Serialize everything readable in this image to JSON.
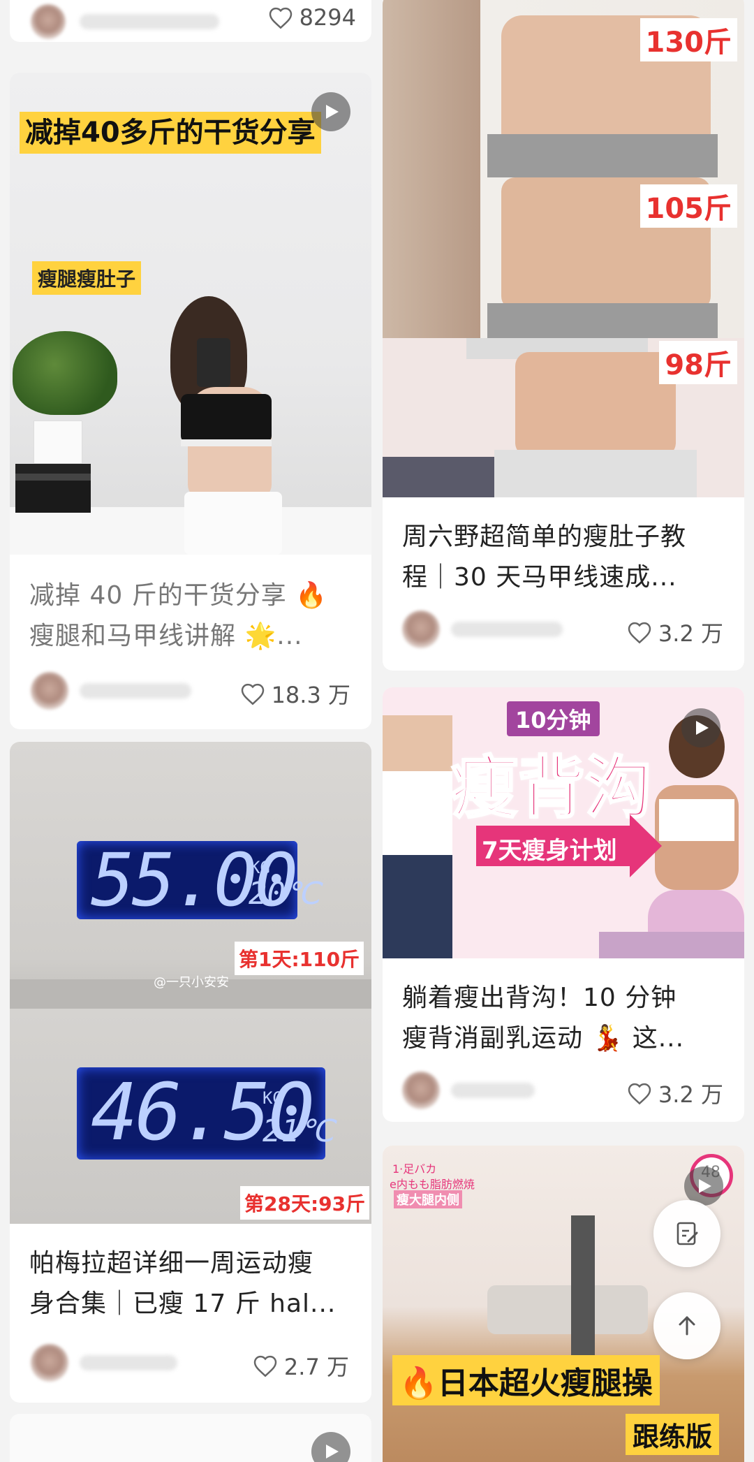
{
  "feed": {
    "left": [
      {
        "title_lines": [],
        "likes": "8294"
      },
      {
        "overlay_title": "减掉40多斤的干货分享",
        "overlay_tag": "瘦腿瘦肚子",
        "title_lines": [
          "减掉 40 斤的干货分享 🔥",
          "瘦腿和马甲线讲解 🌟..."
        ],
        "likes": "18.3 万"
      },
      {
        "scale_top": {
          "value": "55.00",
          "unit": "KG",
          "temp": "20℃"
        },
        "scale_bottom": {
          "value": "46.50",
          "unit": "KG",
          "temp": "21℃"
        },
        "label_day1": "第1天:110斤",
        "label_day28": "第28天:93斤",
        "watermark": "@一只小安安",
        "title_lines": [
          "帕梅拉超详细一周运动瘦",
          "身合集｜已瘦 17 斤 hal..."
        ],
        "likes": "2.7 万"
      }
    ],
    "right": [
      {
        "weights": [
          "130斤",
          "105斤",
          "98斤"
        ],
        "title_lines": [
          "周六野超简单的瘦肚子教",
          "程｜30 天马甲线速成..."
        ],
        "likes": "3.2 万"
      },
      {
        "badge": "10分钟",
        "big_title": "瘦背沟",
        "arrow_text": "7天瘦身计划",
        "title_lines": [
          "躺着瘦出背沟！10 分钟",
          "瘦背消副乳运动 💃 这..."
        ],
        "likes": "3.2 万"
      },
      {
        "banner": "🔥日本超火瘦腿操",
        "sub_banner": "跟练版",
        "corner_label": "1·足バカ",
        "corner_sub": "e内もも脂肪燃焼",
        "corner_pink": "瘦大腿内侧",
        "timer": "48"
      }
    ]
  },
  "colors": {
    "accent_red": "#e8312f",
    "yellow": "#ffd23f",
    "pink": "#e6357a",
    "scale_blue": "#0b1a6b",
    "text": "#222222",
    "muted": "#777777"
  },
  "icons": [
    "heart-icon",
    "play-icon",
    "edit-note-icon",
    "arrow-up-icon"
  ]
}
